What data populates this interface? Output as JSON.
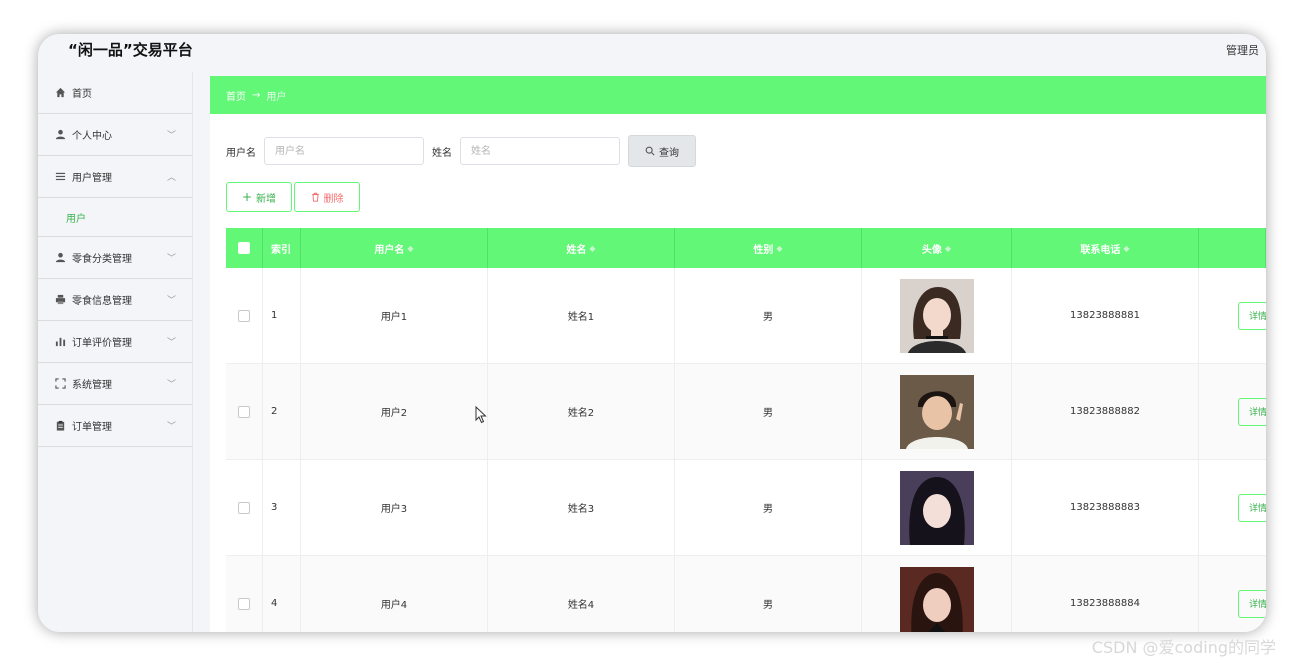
{
  "app": {
    "title": "“闲一品”交易平台",
    "admin_label": "管理员"
  },
  "sidebar": {
    "items": [
      {
        "label": "首页",
        "icon": "home-icon",
        "expandable": false
      },
      {
        "label": "个人中心",
        "icon": "user-icon",
        "expandable": true
      },
      {
        "label": "用户管理",
        "icon": "list-icon",
        "expandable": true,
        "expanded": true
      },
      {
        "label": "零食分类管理",
        "icon": "user-icon",
        "expandable": true
      },
      {
        "label": "零食信息管理",
        "icon": "printer-icon",
        "expandable": true
      },
      {
        "label": "订单评价管理",
        "icon": "bar-chart-icon",
        "expandable": true
      },
      {
        "label": "系统管理",
        "icon": "frame-icon",
        "expandable": true
      },
      {
        "label": "订单管理",
        "icon": "clipboard-icon",
        "expandable": true
      }
    ],
    "sub_item": "用户"
  },
  "breadcrumb": {
    "home": "首页",
    "separator": "→",
    "current": "用户"
  },
  "search": {
    "username_label": "用户名",
    "username_placeholder": "用户名",
    "name_label": "姓名",
    "name_placeholder": "姓名",
    "query_button": "查询"
  },
  "actions": {
    "add": "新增",
    "delete": "删除"
  },
  "table": {
    "columns": [
      "索引",
      "用户名",
      "姓名",
      "性别",
      "头像",
      "联系电话"
    ],
    "rows": [
      {
        "index": "1",
        "username": "用户1",
        "name": "姓名1",
        "sex": "男",
        "phone": "13823888881",
        "action": "详情"
      },
      {
        "index": "2",
        "username": "用户2",
        "name": "姓名2",
        "sex": "男",
        "phone": "13823888882",
        "action": "详情"
      },
      {
        "index": "3",
        "username": "用户3",
        "name": "姓名3",
        "sex": "男",
        "phone": "13823888883",
        "action": "详情"
      },
      {
        "index": "4",
        "username": "用户4",
        "name": "姓名4",
        "sex": "男",
        "phone": "13823888884",
        "action": "详情"
      }
    ]
  },
  "watermark": "CSDN @爱coding的同学",
  "colors": {
    "accent": "#62f777",
    "accent_text": "#37b24d",
    "danger": "#f56c6c"
  }
}
